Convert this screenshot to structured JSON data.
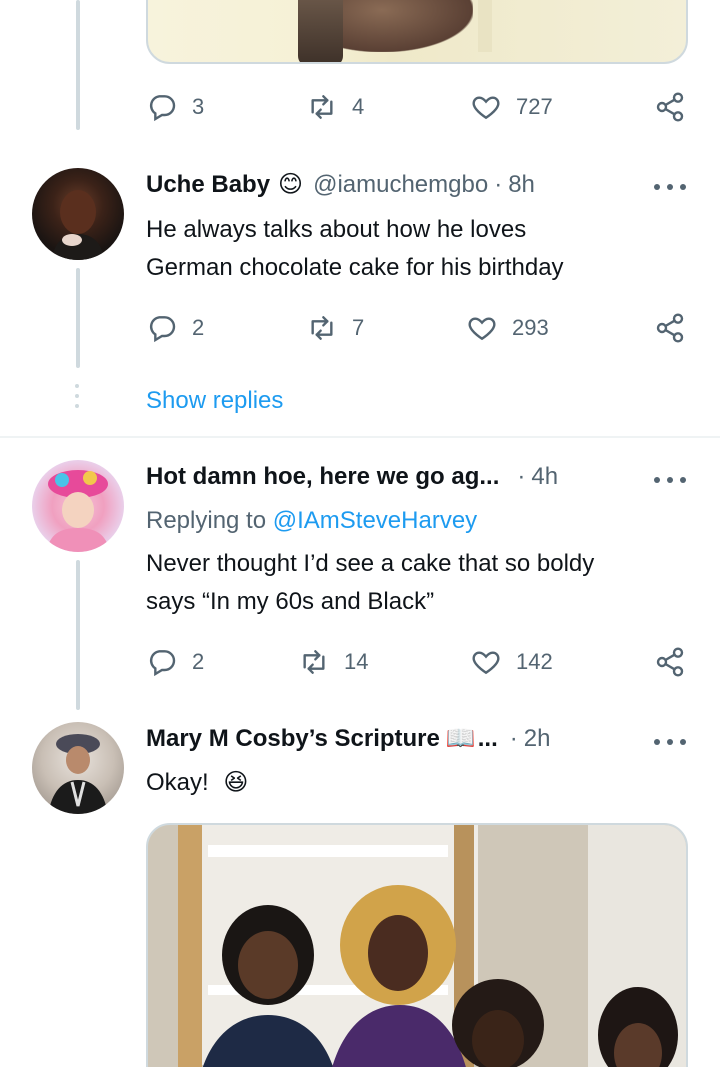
{
  "tweet0": {
    "actions": {
      "reply": "3",
      "retweet": "4",
      "like": "727"
    }
  },
  "tweet1": {
    "name": "Uche Baby",
    "emoji": "😊",
    "handle": "@iamuchemgbo",
    "sep": "·",
    "time": "8h",
    "text_line1": "He always talks about how he loves",
    "text_line2": "German chocolate cake for his birthday",
    "actions": {
      "reply": "2",
      "retweet": "7",
      "like": "293"
    },
    "show_replies": "Show replies"
  },
  "tweet2": {
    "name": "Hot damn hoe, here we go ag...",
    "sep": "·",
    "time": "4h",
    "replying_prefix": "Replying to",
    "replying_to": "@IAmSteveHarvey",
    "text_line1": "Never thought I’d see a cake that so boldy",
    "text_line2": "says “In my 60s and Black”",
    "actions": {
      "reply": "2",
      "retweet": "14",
      "like": "142"
    }
  },
  "tweet3": {
    "name": "Mary M Cosby’s Scripture",
    "name_emoji": "📖",
    "ellipsis": "...",
    "sep": "·",
    "time": "2h",
    "text": "Okay!",
    "text_emoji": "😆"
  },
  "icons": {
    "reply": "reply-icon",
    "retweet": "retweet-icon",
    "like": "heart-icon",
    "share": "share-icon",
    "more": "more-icon"
  },
  "colors": {
    "accent": "#1d9bf0",
    "muted": "#536471",
    "line": "#cfd9de"
  }
}
